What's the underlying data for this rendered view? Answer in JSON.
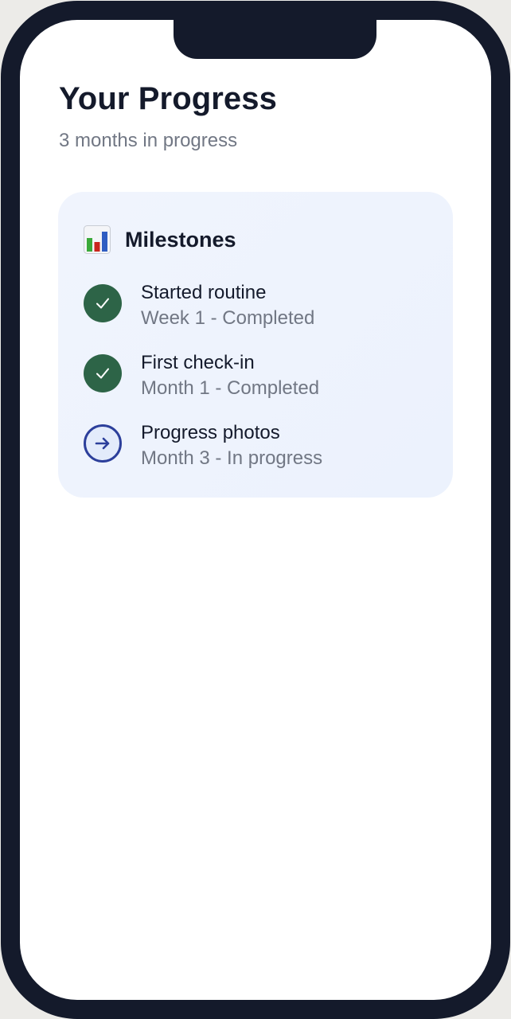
{
  "header": {
    "title": "Your Progress",
    "subtitle": "3 months in progress"
  },
  "milestones_card": {
    "icon": "bar-chart-icon",
    "title": "Milestones",
    "items": [
      {
        "label": "Started routine",
        "status": "Week 1 - Completed",
        "state": "completed",
        "icon": "check-icon"
      },
      {
        "label": "First check-in",
        "status": "Month 1 - Completed",
        "state": "completed",
        "icon": "check-icon"
      },
      {
        "label": "Progress photos",
        "status": "Month 3 - In progress",
        "state": "in-progress",
        "icon": "arrow-right-icon"
      }
    ]
  },
  "colors": {
    "frame": "#141a2b",
    "completed": "#2d6447",
    "in_progress_ring": "#2c3f9b",
    "card_bg": "#eef3fd",
    "muted_text": "#717784"
  }
}
